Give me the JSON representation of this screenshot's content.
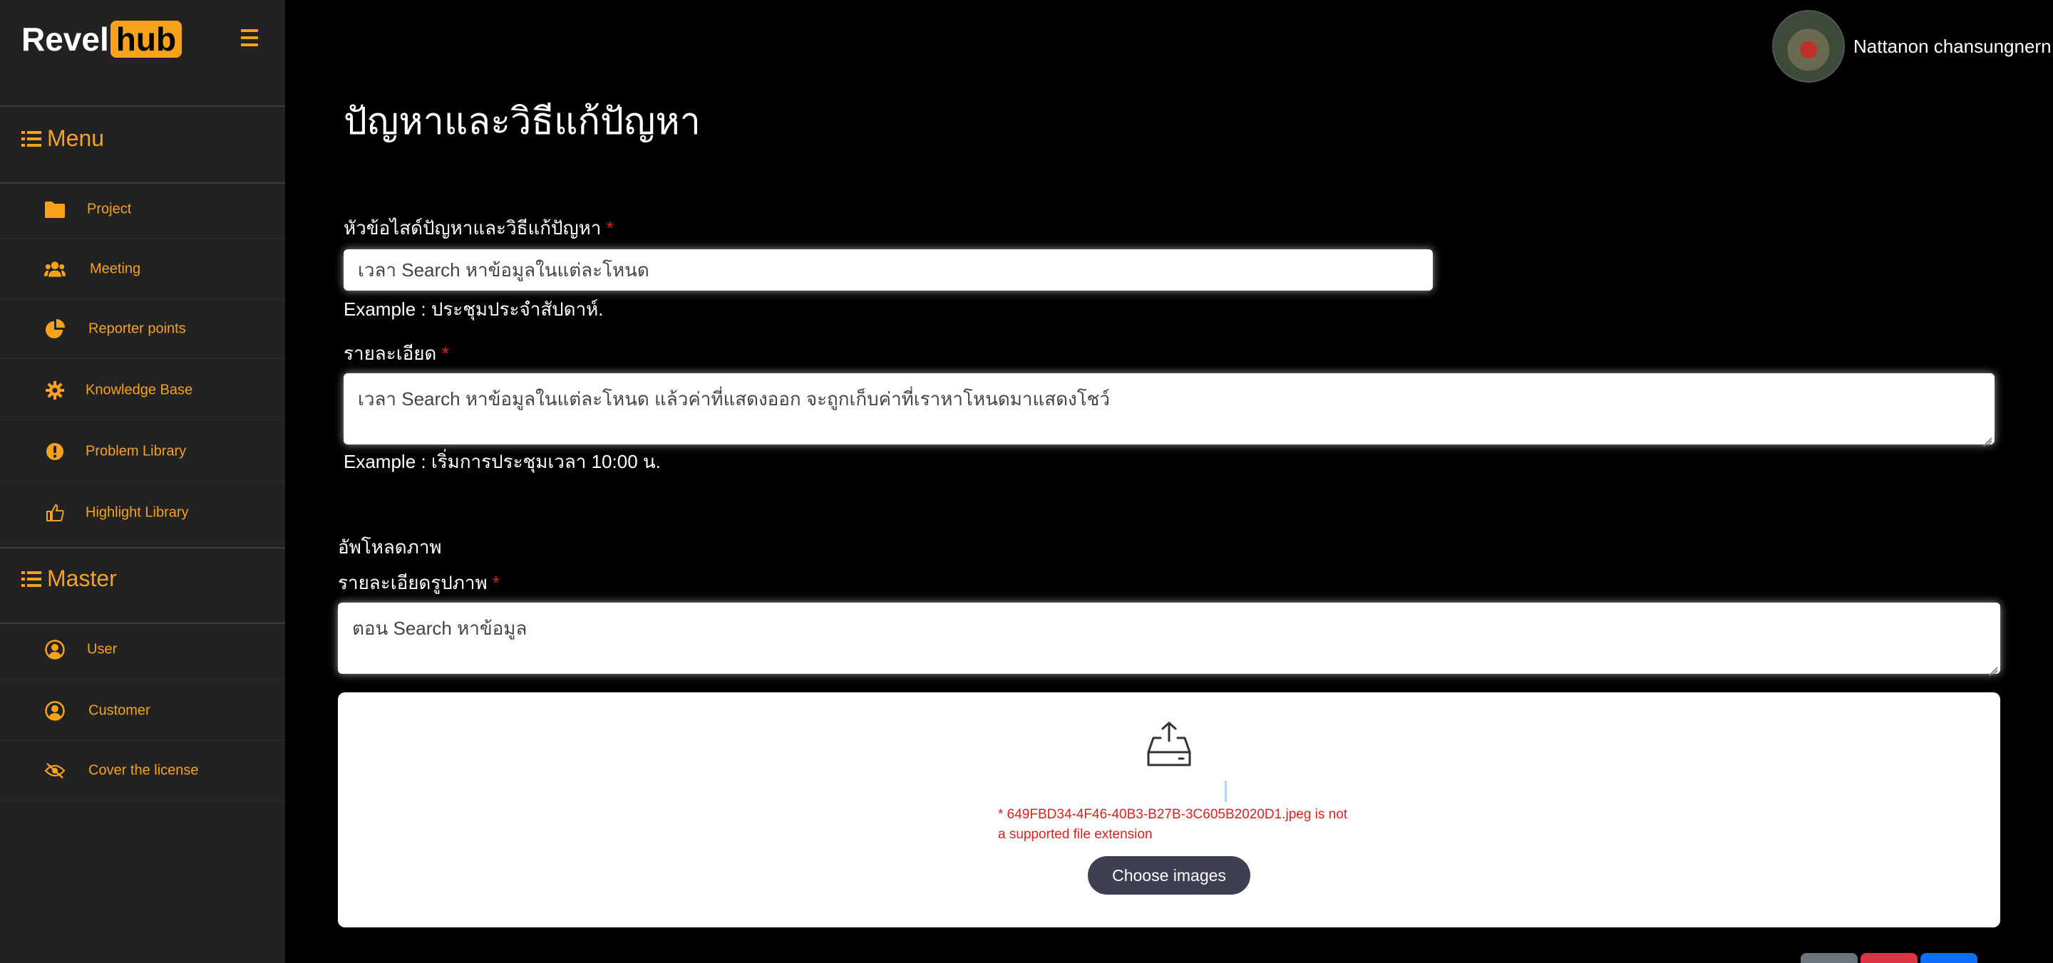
{
  "brand": {
    "part1": "Revel",
    "part2": "hub"
  },
  "sidebar": {
    "menu_header": "Menu",
    "master_header": "Master",
    "menu_items": [
      {
        "label": "Project",
        "icon": "folder-icon"
      },
      {
        "label": "Meeting",
        "icon": "users-icon"
      },
      {
        "label": "Reporter points",
        "icon": "pie-chart-icon"
      },
      {
        "label": "Knowledge Base",
        "icon": "gear-icon"
      },
      {
        "label": "Problem Library",
        "icon": "exclamation-circle-icon"
      },
      {
        "label": "Highlight Library",
        "icon": "thumbs-up-icon"
      }
    ],
    "master_items": [
      {
        "label": "User",
        "icon": "user-circle-icon"
      },
      {
        "label": "Customer",
        "icon": "user-circle-icon"
      },
      {
        "label": "Cover the license",
        "icon": "eye-slash-icon"
      }
    ]
  },
  "user": {
    "name": "Nattanon chansungnern"
  },
  "page": {
    "title": "ปัญหาและวิธีแก้ปัญหา"
  },
  "form": {
    "topic_label": "หัวข้อไสด์ปัญหาและวิธีแก้ปัญหา",
    "topic_value": "เวลา Search หาข้อมูลในแต่ละโหนด",
    "topic_example": "Example : ประชุมประจำสัปดาห์.",
    "detail_label": "รายละเอียด",
    "detail_value": "เวลา Search หาข้อมูลในแต่ละโหนด แล้วค่าที่แสดงออก จะถูกเก็บค่าที่เราหาโหนดมาแสดงโชว์",
    "detail_example": "Example : เริ่มการประชุมเวลา 10:00 น.",
    "upload_header": "อัพโหลดภาพ",
    "image_detail_label": "รายละเอียดรูปภาพ",
    "image_detail_value": "ตอน Search หาข้อมูล",
    "required_mark": "*"
  },
  "upload": {
    "error_text": "* 649FBD34-4F46-40B3-B27B-3C605B2020D1.jpeg is not a supported file extension",
    "button_label": "Choose images"
  },
  "colors": {
    "accent": "#f7a21b",
    "error": "#e02020",
    "sidebar": "#222222"
  }
}
